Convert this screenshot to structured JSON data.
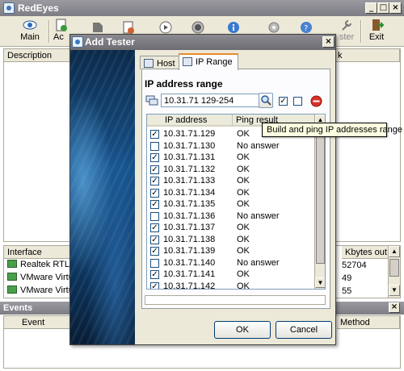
{
  "main": {
    "title": "RedEyes",
    "toolbar": {
      "main_label": "Main",
      "add_label": "Ac",
      "tester_label": "ster",
      "exit_label": "Exit"
    },
    "grid_headers": {
      "description": "Description",
      "k": "k"
    },
    "interfaces": {
      "headers": {
        "interface": "Interface",
        "kbytes_out": "Kbytes out"
      },
      "rows": [
        {
          "name": "Realtek RTL",
          "kbytes_out": "52704"
        },
        {
          "name": "VMware Virtu",
          "kbytes_out": "49"
        },
        {
          "name": "VMware Virtu",
          "kbytes_out": "55"
        }
      ]
    },
    "events": {
      "title": "Events",
      "headers": {
        "event": "Event",
        "method": "Method"
      }
    }
  },
  "dialog": {
    "title": "Add Tester",
    "tabs": [
      {
        "label": "Host"
      },
      {
        "label": "IP Range"
      }
    ],
    "range_heading": "IP address range",
    "range_value": "10.31.71 129-254",
    "list_headers": {
      "ip": "IP address",
      "result": "Ping result"
    },
    "rows": [
      {
        "checked": true,
        "ip": "10.31.71.129",
        "result": "OK"
      },
      {
        "checked": false,
        "ip": "10.31.71.130",
        "result": "No answer"
      },
      {
        "checked": true,
        "ip": "10.31.71.131",
        "result": "OK"
      },
      {
        "checked": true,
        "ip": "10.31.71.132",
        "result": "OK"
      },
      {
        "checked": true,
        "ip": "10.31.71.133",
        "result": "OK"
      },
      {
        "checked": true,
        "ip": "10.31.71.134",
        "result": "OK"
      },
      {
        "checked": true,
        "ip": "10.31.71.135",
        "result": "OK"
      },
      {
        "checked": false,
        "ip": "10.31.71.136",
        "result": "No answer"
      },
      {
        "checked": true,
        "ip": "10.31.71.137",
        "result": "OK"
      },
      {
        "checked": true,
        "ip": "10.31.71.138",
        "result": "OK"
      },
      {
        "checked": true,
        "ip": "10.31.71.139",
        "result": "OK"
      },
      {
        "checked": false,
        "ip": "10.31.71.140",
        "result": "No answer"
      },
      {
        "checked": true,
        "ip": "10.31.71.141",
        "result": "OK"
      },
      {
        "checked": true,
        "ip": "10.31.71.142",
        "result": "OK"
      }
    ],
    "ok_label": "OK",
    "cancel_label": "Cancel",
    "tooltip": "Build and ping IP addresses range"
  },
  "colors": {
    "titlebar": "#7d7d84",
    "window_bg": "#ece9d8",
    "tooltip_bg": "#ffffe1",
    "stop_red": "#d9302a"
  }
}
